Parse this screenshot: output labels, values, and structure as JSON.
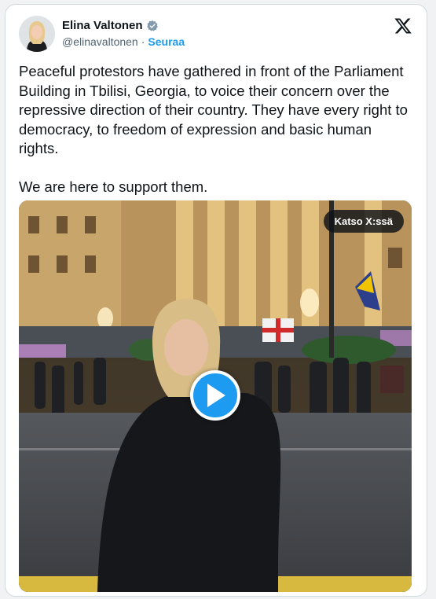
{
  "author": {
    "name": "Elina Valtonen",
    "handle": "@elinavaltonen",
    "separator": "·",
    "follow_label": "Seuraa"
  },
  "tweet": {
    "text": "Peaceful protestors have gathered in front of the Parliament Building in Tbilisi, Georgia, to voice their concern over the repressive direction of their country. They have every right to democracy, to freedom of expression and basic human rights.\n\nWe are here to support them."
  },
  "media": {
    "watch_label": "Katso X:ssä",
    "icon": "play-icon"
  },
  "colors": {
    "accent": "#1d9bf0",
    "text": "#0f1419",
    "muted": "#536471"
  }
}
